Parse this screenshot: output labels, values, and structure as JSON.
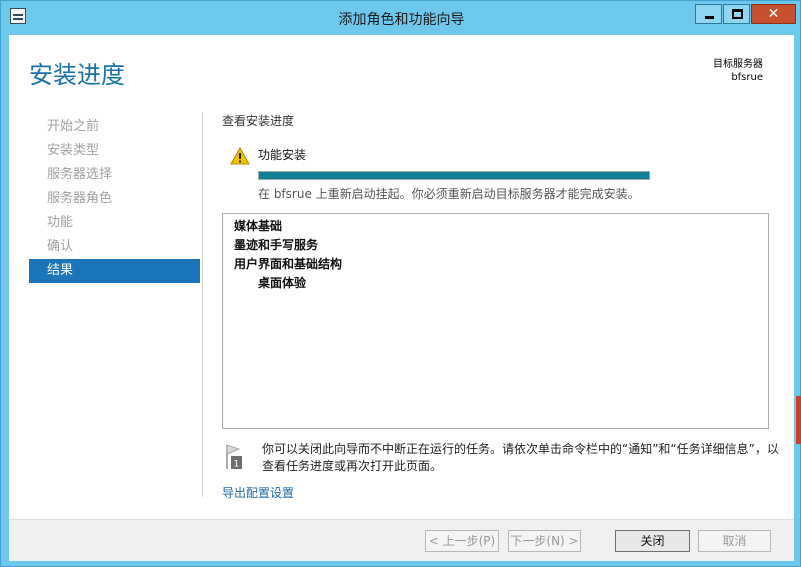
{
  "window": {
    "title": "添加角色和功能向导",
    "close_glyph": "✕"
  },
  "page": {
    "title": "安装进度",
    "server_label": "目标服务器",
    "server_name": "bfsrue"
  },
  "nav": {
    "items": [
      {
        "label": "开始之前"
      },
      {
        "label": "安装类型"
      },
      {
        "label": "服务器选择"
      },
      {
        "label": "服务器角色"
      },
      {
        "label": "功能"
      },
      {
        "label": "确认"
      },
      {
        "label": "结果"
      }
    ],
    "active_index": 6
  },
  "progress": {
    "heading": "查看安装进度",
    "feature_label": "功能安装",
    "value": 1.0,
    "status": "在 bfsrue 上重新启动挂起。你必须重新启动目标服务器才能完成安装。"
  },
  "results": [
    {
      "text": "媒体基础",
      "indent": 0
    },
    {
      "text": "墨迹和手写服务",
      "indent": 0
    },
    {
      "text": "用户界面和基础结构",
      "indent": 0
    },
    {
      "text": "桌面体验",
      "indent": 1
    }
  ],
  "note": {
    "text": "你可以关闭此向导而不中断正在运行的任务。请依次单击命令栏中的“通知”和“任务详细信息”，以查看任务进度或再次打开此页面。",
    "badge": "1"
  },
  "export_link": "导出配置设置",
  "buttons": {
    "prev": "< 上一步(P)",
    "next": "下一步(N) >",
    "close": "关闭",
    "cancel": "取消"
  },
  "colors": {
    "accent": "#1c75b8",
    "progress": "#137f96",
    "titlebar": "#6dc8ec"
  }
}
